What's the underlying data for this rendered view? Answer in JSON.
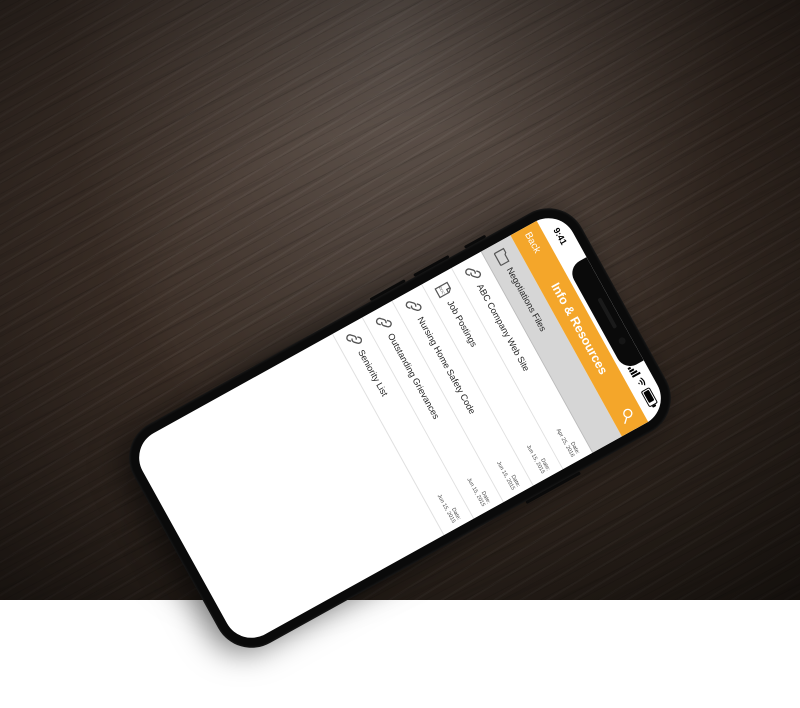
{
  "status": {
    "time": "9:41"
  },
  "nav": {
    "back": "Back",
    "title": "Info & Resources"
  },
  "date_label": "Date:",
  "rows": [
    {
      "icon": "folder",
      "label": "Negotiations Files",
      "date": "",
      "selected": true
    },
    {
      "icon": "link",
      "label": "ABC Company Web Site",
      "date": "Apr 25, 2016",
      "selected": false
    },
    {
      "icon": "doc",
      "label": "Job Postings",
      "date": "Jun 15, 2015",
      "selected": false
    },
    {
      "icon": "link",
      "label": "Nursing Home Safety Code",
      "date": "Jun 15, 2015",
      "selected": false
    },
    {
      "icon": "link",
      "label": "Outstanding Grievances",
      "date": "Jun 15, 2015",
      "selected": false
    },
    {
      "icon": "link",
      "label": "Seniority List",
      "date": "Jun 15, 2015",
      "selected": false
    }
  ]
}
